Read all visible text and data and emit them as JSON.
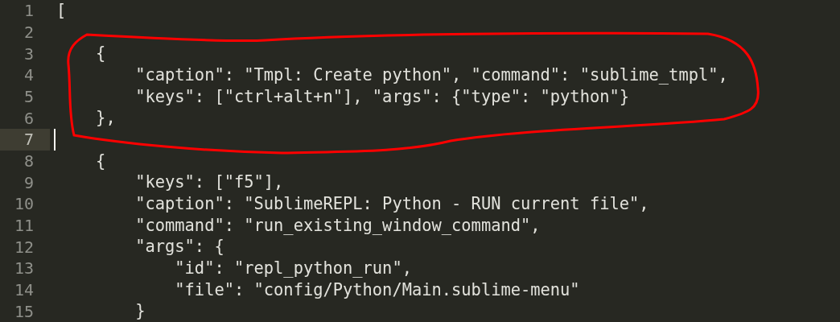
{
  "editor": {
    "lines": [
      {
        "number": "1",
        "code": "[",
        "current": false
      },
      {
        "number": "2",
        "current": false
      },
      {
        "number": "3",
        "code": "    {",
        "current": false
      },
      {
        "number": "4",
        "code": "        \"caption\": \"Tmpl: Create python\", \"command\": \"sublime_tmpl\",",
        "current": false
      },
      {
        "number": "5",
        "code": "        \"keys\": [\"ctrl+alt+n\"], \"args\": {\"type\": \"python\"}",
        "current": false
      },
      {
        "number": "6",
        "code": "    },",
        "current": false
      },
      {
        "number": "7",
        "current": true
      },
      {
        "number": "8",
        "code": "    {",
        "current": false
      },
      {
        "number": "9",
        "code": "        \"keys\": [\"f5\"],",
        "current": false
      },
      {
        "number": "10",
        "code": "        \"caption\": \"SublimeREPL: Python - RUN current file\",",
        "current": false
      },
      {
        "number": "11",
        "code": "        \"command\": \"run_existing_window_command\",",
        "current": false
      },
      {
        "number": "12",
        "code": "        \"args\": {",
        "current": false
      },
      {
        "number": "13",
        "code": "            \"id\": \"repl_python_run\",",
        "current": false
      },
      {
        "number": "14",
        "code": "            \"file\": \"config/Python/Main.sublime-menu\"",
        "current": false
      },
      {
        "number": "15",
        "code": "        }",
        "current": false
      }
    ]
  }
}
